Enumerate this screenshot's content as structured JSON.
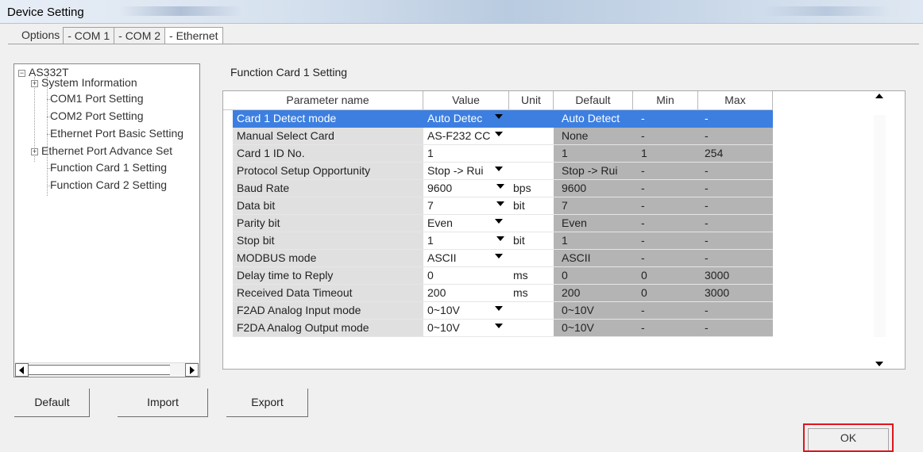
{
  "window": {
    "title": "Device Setting"
  },
  "tabs": [
    {
      "label": "Options",
      "active": false
    },
    {
      "label": "- COM 1",
      "active": false
    },
    {
      "label": "- COM 2",
      "active": false
    },
    {
      "label": "- Ethernet",
      "active": true
    }
  ],
  "tree": {
    "root": "AS332T",
    "items": [
      {
        "label": "System Information",
        "expandable": true
      },
      {
        "label": "COM1 Port Setting",
        "expandable": false
      },
      {
        "label": "COM2 Port Setting",
        "expandable": false
      },
      {
        "label": "Ethernet Port Basic Setting",
        "expandable": false
      },
      {
        "label": "Ethernet Port Advance Set",
        "expandable": true
      },
      {
        "label": "Function Card 1 Setting",
        "expandable": false
      },
      {
        "label": "Function Card 2 Setting",
        "expandable": false
      }
    ]
  },
  "section": {
    "title": "Function Card 1 Setting"
  },
  "table": {
    "headers": [
      "Parameter name",
      "Value",
      "Unit",
      "Default",
      "Min",
      "Max"
    ],
    "rows": [
      {
        "name": "Card 1 Detect mode",
        "value": "Auto Detec",
        "dropdown": true,
        "unit": "",
        "default": "Auto Detect",
        "min": "-",
        "max": "-",
        "selected": true
      },
      {
        "name": "Manual Select Card",
        "value": "AS-F232 CC",
        "dropdown": true,
        "unit": "",
        "default": "None",
        "min": "-",
        "max": "-"
      },
      {
        "name": "Card 1 ID No.",
        "value": "1",
        "dropdown": false,
        "unit": "",
        "default": "1",
        "min": "1",
        "max": "254"
      },
      {
        "name": "Protocol Setup Opportunity",
        "value": "Stop -> Rui",
        "dropdown": true,
        "unit": "",
        "default": "Stop -> Rui",
        "min": "-",
        "max": "-"
      },
      {
        "name": "Baud Rate",
        "value": "9600",
        "dropdown": true,
        "unit": "bps",
        "default": "9600",
        "min": "-",
        "max": "-"
      },
      {
        "name": "Data bit",
        "value": "7",
        "dropdown": true,
        "unit": "bit",
        "default": "7",
        "min": "-",
        "max": "-"
      },
      {
        "name": "Parity bit",
        "value": "Even",
        "dropdown": true,
        "unit": "",
        "default": "Even",
        "min": "-",
        "max": "-"
      },
      {
        "name": "Stop bit",
        "value": "1",
        "dropdown": true,
        "unit": "bit",
        "default": "1",
        "min": "-",
        "max": "-"
      },
      {
        "name": "MODBUS mode",
        "value": "ASCII",
        "dropdown": true,
        "unit": "",
        "default": "ASCII",
        "min": "-",
        "max": "-"
      },
      {
        "name": "Delay time to Reply",
        "value": "0",
        "dropdown": false,
        "unit": "ms",
        "default": "0",
        "min": "0",
        "max": "3000"
      },
      {
        "name": "Received Data Timeout",
        "value": "200",
        "dropdown": false,
        "unit": "ms",
        "default": "200",
        "min": "0",
        "max": "3000"
      },
      {
        "name": "F2AD Analog Input mode",
        "value": "0~10V",
        "dropdown": true,
        "unit": "",
        "default": "0~10V",
        "min": "-",
        "max": "-"
      },
      {
        "name": "F2DA Analog Output mode",
        "value": "0~10V",
        "dropdown": true,
        "unit": "",
        "default": "0~10V",
        "min": "-",
        "max": "-"
      }
    ]
  },
  "buttons": {
    "default": "Default",
    "import": "Import",
    "export": "Export",
    "ok": "OK"
  },
  "colors": {
    "selection": "#3d7fe0",
    "highlight_border": "#e0141e"
  }
}
